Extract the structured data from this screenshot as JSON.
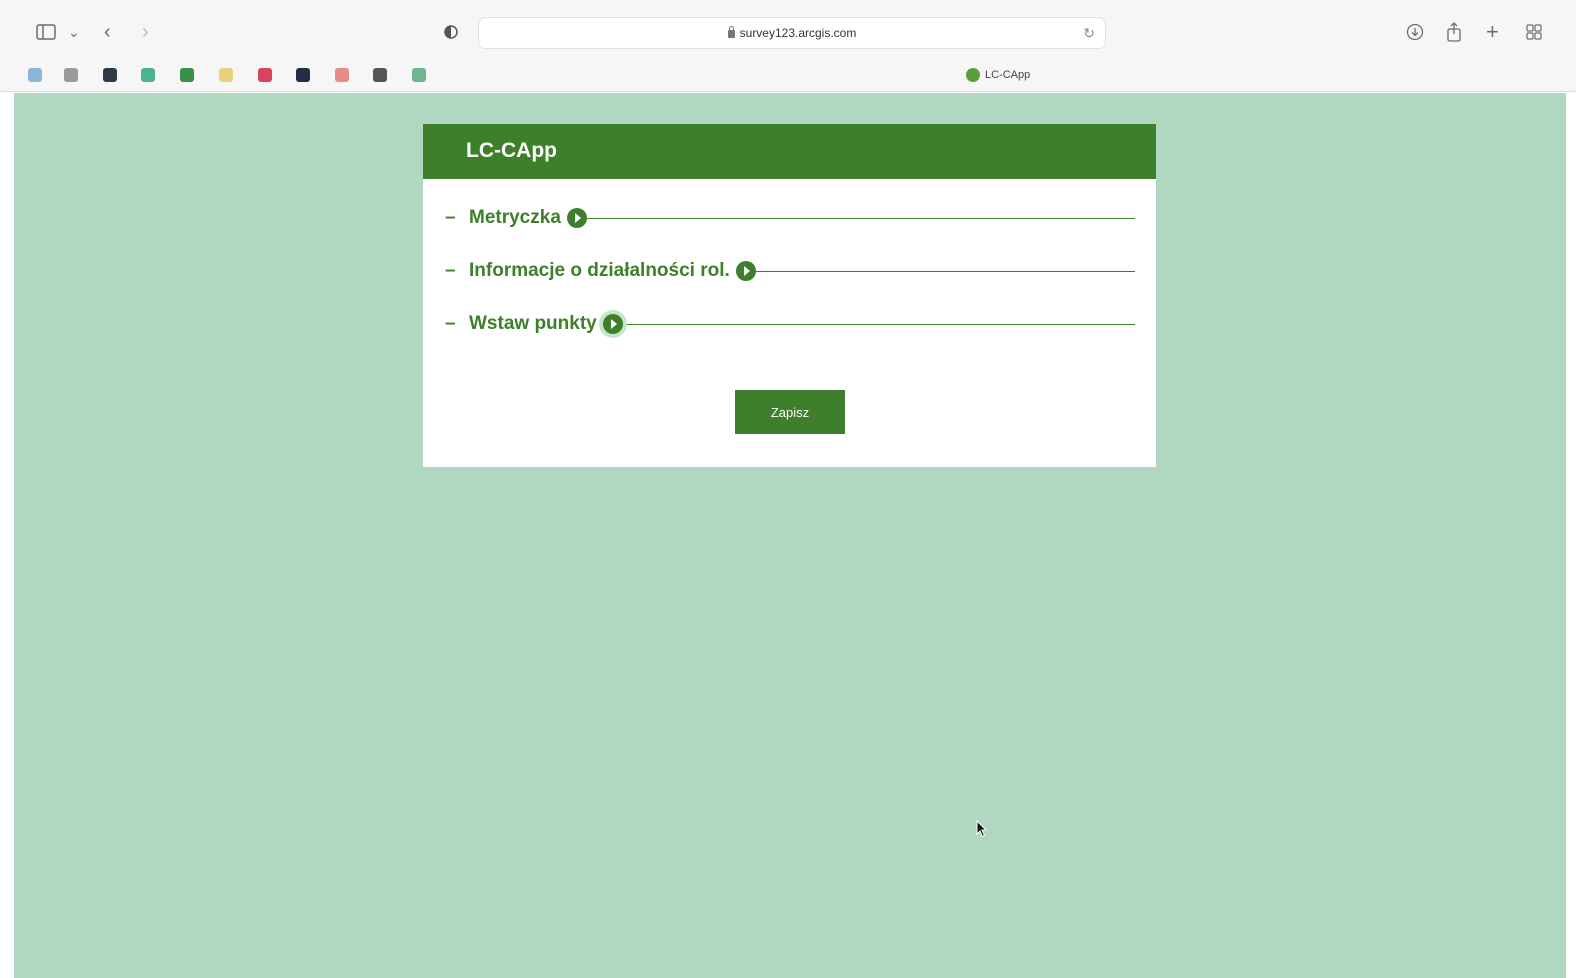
{
  "browser": {
    "url": "survey123.arcgis.com",
    "tab_title": "LC-CApp",
    "icons": [
      "sidebar-icon",
      "chevron-down-icon",
      "back-icon",
      "forward-icon",
      "privacy-shield-icon",
      "reload-icon",
      "download-icon",
      "share-icon",
      "new-tab-icon",
      "tab-overview-icon"
    ],
    "bookmark_colors": [
      "#8fb4d9",
      "#9a9a9a",
      "#2d3a4a",
      "#4cb48c",
      "#3b8f4c",
      "#e7d27b",
      "#d6455d",
      "#222d44",
      "#e88a8a",
      "#555555",
      "#6fb58f"
    ]
  },
  "form": {
    "title": "LC-CApp",
    "groups": [
      {
        "label": "Metryczka",
        "collapse_symbol": "–"
      },
      {
        "label": "Informacje o działalności rol.",
        "collapse_symbol": "–"
      },
      {
        "label": "Wstaw punkty",
        "collapse_symbol": "–"
      }
    ],
    "save_label": "Zapisz"
  },
  "colors": {
    "brand_green": "#3d7f2b",
    "page_background": "#b0d8c0"
  }
}
